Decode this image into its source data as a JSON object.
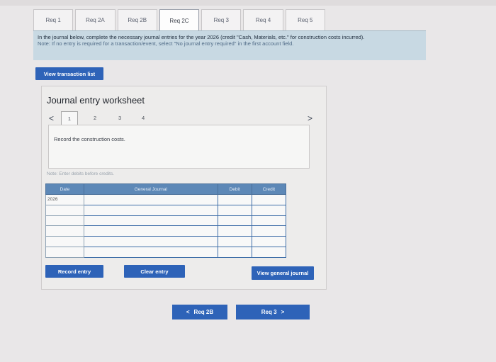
{
  "tabs": [
    "Req 1",
    "Req 2A",
    "Req 2B",
    "Req 2C",
    "Req 3",
    "Req 4",
    "Req 5"
  ],
  "active_tab_index": 3,
  "instructions": {
    "main": "In the journal below, complete the necessary journal entries for the year 2026 (credit \"Cash, Materials, etc.\" for construction costs incurred).",
    "note": "Note: If no entry is required for a transaction/event, select \"No journal entry required\" in the first account field."
  },
  "view_transaction_label": "View transaction list",
  "worksheet": {
    "title": "Journal entry worksheet",
    "pages": [
      "1",
      "2",
      "3",
      "4"
    ],
    "prev_icon": "<",
    "next_icon": ">",
    "instruction": "Record the construction costs.",
    "note": "Note: Enter debits before credits.",
    "columns": {
      "date": "Date",
      "general_journal": "General Journal",
      "debit": "Debit",
      "credit": "Credit"
    },
    "rows": [
      {
        "date": "2026",
        "account": "",
        "debit": "",
        "credit": ""
      },
      {
        "date": "",
        "account": "",
        "debit": "",
        "credit": ""
      },
      {
        "date": "",
        "account": "",
        "debit": "",
        "credit": ""
      },
      {
        "date": "",
        "account": "",
        "debit": "",
        "credit": ""
      },
      {
        "date": "",
        "account": "",
        "debit": "",
        "credit": ""
      },
      {
        "date": "",
        "account": "",
        "debit": "",
        "credit": ""
      }
    ],
    "record_label": "Record entry",
    "clear_label": "Clear entry",
    "view_journal_label": "View general journal"
  },
  "prev_req": {
    "icon": "<",
    "label": "Req 2B"
  },
  "next_req": {
    "label": "Req 3",
    "icon": ">"
  },
  "colors": {
    "primary": "#2e63b8",
    "table_header": "#5d88b7",
    "info_bg": "#c8d9e3"
  }
}
